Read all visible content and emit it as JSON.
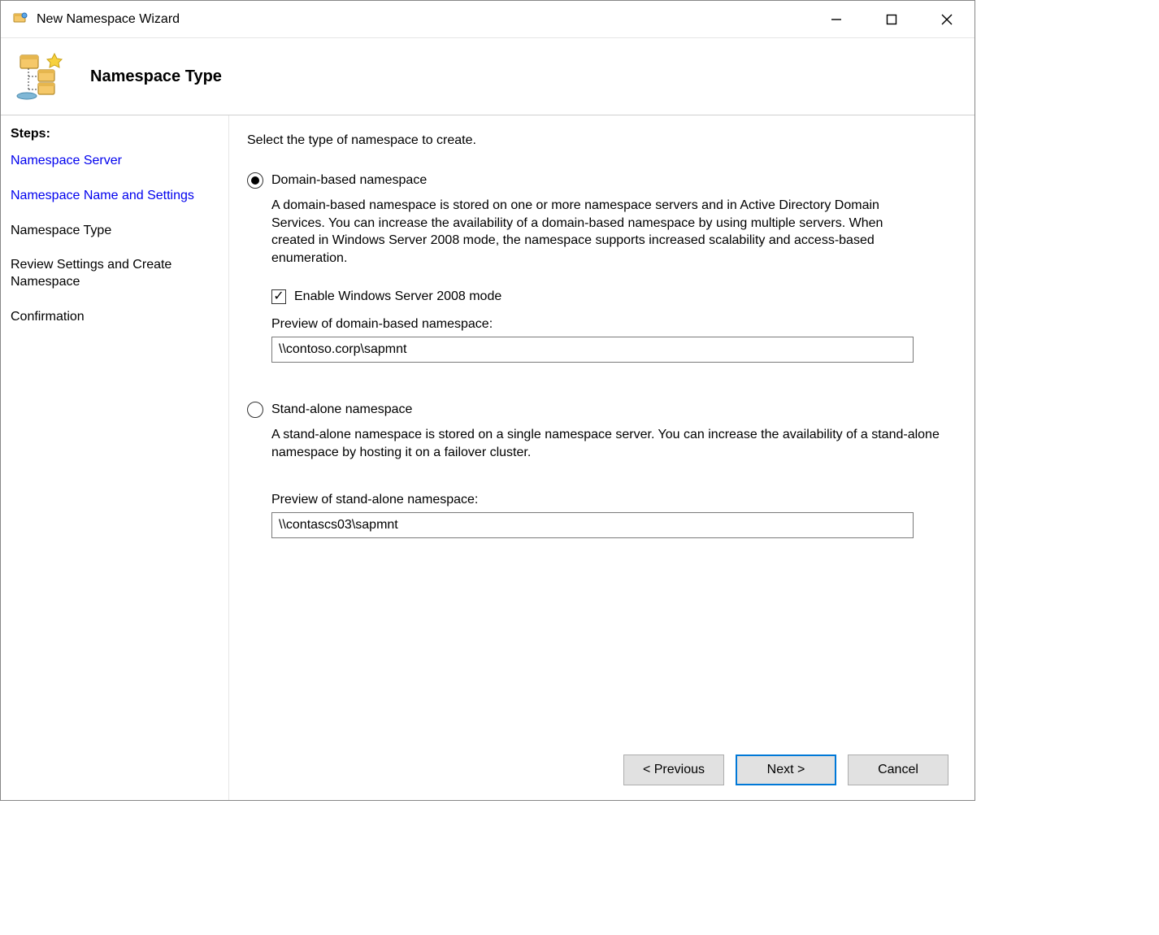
{
  "titlebar": {
    "title": "New Namespace Wizard"
  },
  "header": {
    "title": "Namespace Type"
  },
  "sidebar": {
    "heading": "Steps:",
    "items": [
      {
        "label": "Namespace Server",
        "state": "link"
      },
      {
        "label": "Namespace Name and Settings",
        "state": "link"
      },
      {
        "label": "Namespace Type",
        "state": "current"
      },
      {
        "label": "Review Settings and Create Namespace",
        "state": "future"
      },
      {
        "label": "Confirmation",
        "state": "future"
      }
    ]
  },
  "main": {
    "instruction": "Select the type of namespace to create.",
    "option1": {
      "label": "Domain-based namespace",
      "description": "A domain-based namespace is stored on one or more namespace servers and in Active Directory Domain Services. You can increase the availability of a domain-based namespace by using multiple servers. When created in Windows Server 2008 mode, the namespace supports increased scalability and access-based enumeration.",
      "checkbox_label": "Enable Windows Server 2008 mode",
      "preview_label": "Preview of domain-based namespace:",
      "preview_value": "\\\\contoso.corp\\sapmnt"
    },
    "option2": {
      "label": "Stand-alone namespace",
      "description": "A stand-alone namespace is stored on a single namespace server. You can increase the availability of a stand-alone namespace by hosting it on a failover cluster.",
      "preview_label": "Preview of stand-alone namespace:",
      "preview_value": "\\\\contascs03\\sapmnt"
    }
  },
  "buttons": {
    "previous": "< Previous",
    "next": "Next >",
    "cancel": "Cancel"
  }
}
